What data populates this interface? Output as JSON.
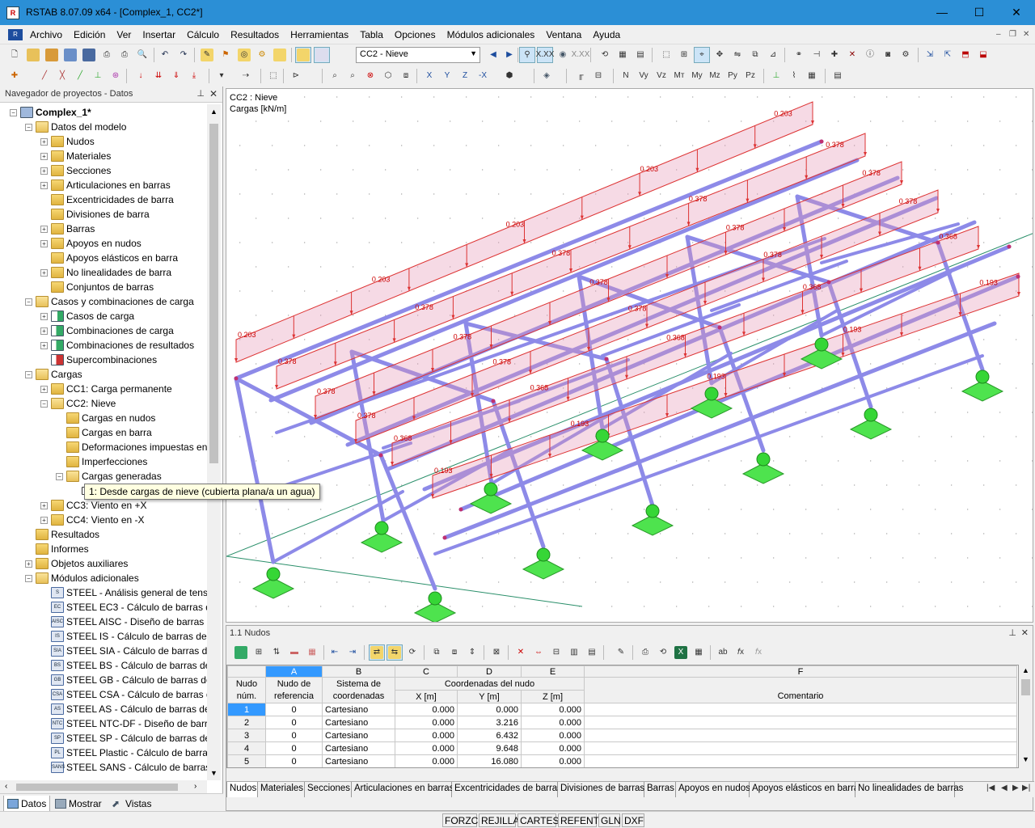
{
  "window": {
    "title": "RSTAB 8.07.09 x64 - [Complex_1, CC2*]",
    "minimize": "—",
    "maximize": "☐",
    "close": "✕"
  },
  "menu": [
    "Archivo",
    "Edición",
    "Ver",
    "Insertar",
    "Cálculo",
    "Resultados",
    "Herramientas",
    "Tabla",
    "Opciones",
    "Módulos adicionales",
    "Ventana",
    "Ayuda"
  ],
  "toolbar": {
    "loadcase_combo": "CC2 - Nieve"
  },
  "navigator": {
    "title": "Navegador de proyectos - Datos",
    "items": [
      {
        "label": "Complex_1*",
        "level": 0,
        "exp": "-",
        "icon": "model-icon",
        "bold": true
      },
      {
        "label": "Datos del modelo",
        "level": 1,
        "exp": "-",
        "icon": "folder-open-icon"
      },
      {
        "label": "Nudos",
        "level": 2,
        "exp": "+",
        "icon": "folder-icon"
      },
      {
        "label": "Materiales",
        "level": 2,
        "exp": "+",
        "icon": "folder-icon"
      },
      {
        "label": "Secciones",
        "level": 2,
        "exp": "+",
        "icon": "folder-icon"
      },
      {
        "label": "Articulaciones en barras",
        "level": 2,
        "exp": "+",
        "icon": "folder-icon"
      },
      {
        "label": "Excentricidades de barra",
        "level": 2,
        "exp": "",
        "icon": "folder-icon"
      },
      {
        "label": "Divisiones de barra",
        "level": 2,
        "exp": "",
        "icon": "folder-icon"
      },
      {
        "label": "Barras",
        "level": 2,
        "exp": "+",
        "icon": "folder-icon"
      },
      {
        "label": "Apoyos en nudos",
        "level": 2,
        "exp": "+",
        "icon": "folder-icon"
      },
      {
        "label": "Apoyos elásticos en barra",
        "level": 2,
        "exp": "",
        "icon": "folder-icon"
      },
      {
        "label": "No linealidades de barra",
        "level": 2,
        "exp": "+",
        "icon": "folder-icon"
      },
      {
        "label": "Conjuntos de barras",
        "level": 2,
        "exp": "",
        "icon": "folder-icon"
      },
      {
        "label": "Casos y combinaciones de carga",
        "level": 1,
        "exp": "-",
        "icon": "folder-open-icon"
      },
      {
        "label": "Casos de carga",
        "level": 2,
        "exp": "+",
        "icon": "loadcase-icon"
      },
      {
        "label": "Combinaciones de carga",
        "level": 2,
        "exp": "+",
        "icon": "combination-icon"
      },
      {
        "label": "Combinaciones de resultados",
        "level": 2,
        "exp": "+",
        "icon": "combination-icon"
      },
      {
        "label": "Supercombinaciones",
        "level": 2,
        "exp": "",
        "icon": "supercombination-icon"
      },
      {
        "label": "Cargas",
        "level": 1,
        "exp": "-",
        "icon": "folder-open-icon"
      },
      {
        "label": "CC1: Carga permanente",
        "level": 2,
        "exp": "+",
        "icon": "folder-icon"
      },
      {
        "label": "CC2: Nieve",
        "level": 2,
        "exp": "-",
        "icon": "folder-open-icon"
      },
      {
        "label": "Cargas en nudos",
        "level": 3,
        "exp": "",
        "icon": "folder-icon"
      },
      {
        "label": "Cargas en barra",
        "level": 3,
        "exp": "",
        "icon": "folder-icon"
      },
      {
        "label": "Deformaciones impuestas en",
        "level": 3,
        "exp": "",
        "icon": "folder-icon"
      },
      {
        "label": "Imperfecciones",
        "level": 3,
        "exp": "",
        "icon": "folder-icon"
      },
      {
        "label": "Cargas generadas",
        "level": 3,
        "exp": "-",
        "icon": "folder-open-icon"
      },
      {
        "label": "",
        "level": 4,
        "exp": "",
        "icon": "generated-load-icon"
      },
      {
        "label": "CC3: Viento en +X",
        "level": 2,
        "exp": "+",
        "icon": "folder-icon"
      },
      {
        "label": "CC4: Viento en -X",
        "level": 2,
        "exp": "+",
        "icon": "folder-icon"
      },
      {
        "label": "Resultados",
        "level": 1,
        "exp": "",
        "icon": "folder-icon"
      },
      {
        "label": "Informes",
        "level": 1,
        "exp": "",
        "icon": "folder-icon"
      },
      {
        "label": "Objetos auxiliares",
        "level": 1,
        "exp": "+",
        "icon": "folder-icon"
      },
      {
        "label": "Módulos adicionales",
        "level": 1,
        "exp": "-",
        "icon": "folder-open-icon"
      },
      {
        "label": "STEEL - Análisis general de tensi",
        "level": 2,
        "exp": "",
        "icon": "module-icon",
        "tag": "S"
      },
      {
        "label": "STEEL EC3 - Cálculo de barras d",
        "level": 2,
        "exp": "",
        "icon": "module-icon",
        "tag": "EC"
      },
      {
        "label": "STEEL AISC - Diseño de barras d",
        "level": 2,
        "exp": "",
        "icon": "module-icon",
        "tag": "AISC"
      },
      {
        "label": "STEEL IS - Cálculo de barras de a",
        "level": 2,
        "exp": "",
        "icon": "module-icon",
        "tag": "IS"
      },
      {
        "label": "STEEL SIA - Cálculo de barras de",
        "level": 2,
        "exp": "",
        "icon": "module-icon",
        "tag": "SIA"
      },
      {
        "label": "STEEL BS - Cálculo de barras de",
        "level": 2,
        "exp": "",
        "icon": "module-icon",
        "tag": "BS"
      },
      {
        "label": "STEEL GB - Cálculo de barras de",
        "level": 2,
        "exp": "",
        "icon": "module-icon",
        "tag": "GB"
      },
      {
        "label": "STEEL CSA - Cálculo de barras de",
        "level": 2,
        "exp": "",
        "icon": "module-icon",
        "tag": "CSA"
      },
      {
        "label": "STEEL AS - Cálculo de barras de",
        "level": 2,
        "exp": "",
        "icon": "module-icon",
        "tag": "AS"
      },
      {
        "label": "STEEL NTC-DF - Diseño de barra",
        "level": 2,
        "exp": "",
        "icon": "module-icon",
        "tag": "NTC"
      },
      {
        "label": "STEEL SP - Cálculo de barras de",
        "level": 2,
        "exp": "",
        "icon": "module-icon",
        "tag": "SP"
      },
      {
        "label": "STEEL Plastic - Cálculo de barras",
        "level": 2,
        "exp": "",
        "icon": "module-icon",
        "tag": "PL"
      },
      {
        "label": "STEEL SANS - Cálculo de barras",
        "level": 2,
        "exp": "",
        "icon": "module-icon",
        "tag": "SANS"
      }
    ],
    "tabs": [
      "Datos",
      "Mostrar",
      "Vistas"
    ]
  },
  "tooltip": "1: Desde cargas de nieve (cubierta plana/a un agua)",
  "viewport": {
    "line1": "CC2 : Nieve",
    "line2": "Cargas [kN/m]",
    "load_labels": [
      "0.203",
      "0.378",
      "0.368",
      "0.193"
    ]
  },
  "table": {
    "title": "1.1 Nudos",
    "col_letters": [
      "A",
      "B",
      "C",
      "D",
      "E",
      "F"
    ],
    "header_row1": {
      "rownum": "Nudo",
      "ref": "Nudo de",
      "sys": "Sistema de",
      "coords": "Coordenadas del nudo",
      "comment": ""
    },
    "header_row2": {
      "rownum": "núm.",
      "ref": "referencia",
      "sys": "coordenadas",
      "x": "X [m]",
      "y": "Y [m]",
      "z": "Z [m]",
      "comment": "Comentario"
    },
    "rows": [
      {
        "n": "1",
        "ref": "0",
        "sys": "Cartesiano",
        "x": "0.000",
        "y": "0.000",
        "z": "0.000"
      },
      {
        "n": "2",
        "ref": "0",
        "sys": "Cartesiano",
        "x": "0.000",
        "y": "3.216",
        "z": "0.000"
      },
      {
        "n": "3",
        "ref": "0",
        "sys": "Cartesiano",
        "x": "0.000",
        "y": "6.432",
        "z": "0.000"
      },
      {
        "n": "4",
        "ref": "0",
        "sys": "Cartesiano",
        "x": "0.000",
        "y": "9.648",
        "z": "0.000"
      },
      {
        "n": "5",
        "ref": "0",
        "sys": "Cartesiano",
        "x": "0.000",
        "y": "16.080",
        "z": "0.000"
      }
    ],
    "tabs": [
      "Nudos",
      "Materiales",
      "Secciones",
      "Articulaciones en barras",
      "Excentricidades de barras",
      "Divisiones de barras",
      "Barras",
      "Apoyos en nudos",
      "Apoyos elásticos en barra",
      "No linealidades de barras"
    ]
  },
  "statusbar": [
    "FORZC",
    "REJILLA",
    "CARTES",
    "REFENT",
    "GLN",
    "DXF"
  ]
}
